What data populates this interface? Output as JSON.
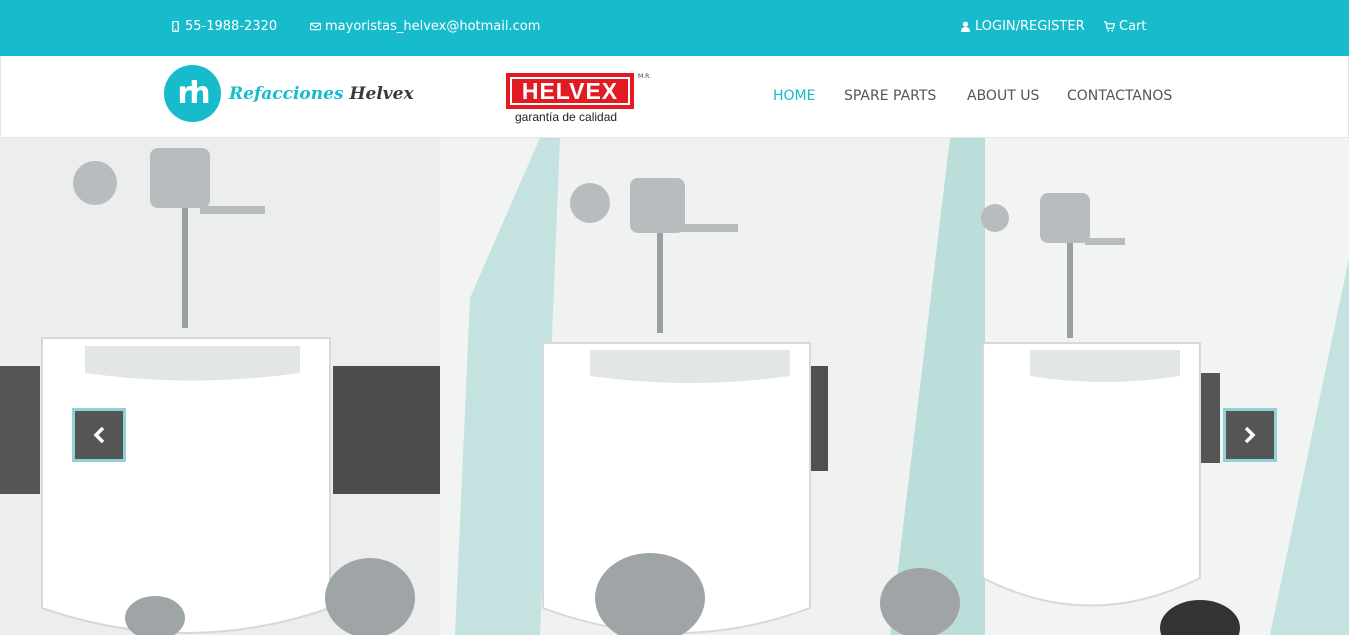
{
  "topbar": {
    "phone": "55-1988-2320",
    "email": "mayoristas_helvex@hotmail.com",
    "login": "LOGIN/REGISTER",
    "cart": "Cart"
  },
  "header": {
    "logo_mark": "rh",
    "logo_text_a": "Refacciones",
    "logo_text_b": "Helvex",
    "brand_name": "HELVEX",
    "brand_mark": "M.R.",
    "brand_tagline": "garantía de calidad"
  },
  "nav": {
    "items": [
      {
        "label": "HOME"
      },
      {
        "label": "SPARE PARTS"
      },
      {
        "label": "ABOUT US"
      },
      {
        "label": "CONTACTANOS"
      }
    ]
  },
  "hero": {
    "prev_icon": "chevron-left-icon",
    "next_icon": "chevron-right-icon"
  },
  "colors": {
    "accent": "#16bccc",
    "brand_red": "#e11b22"
  }
}
